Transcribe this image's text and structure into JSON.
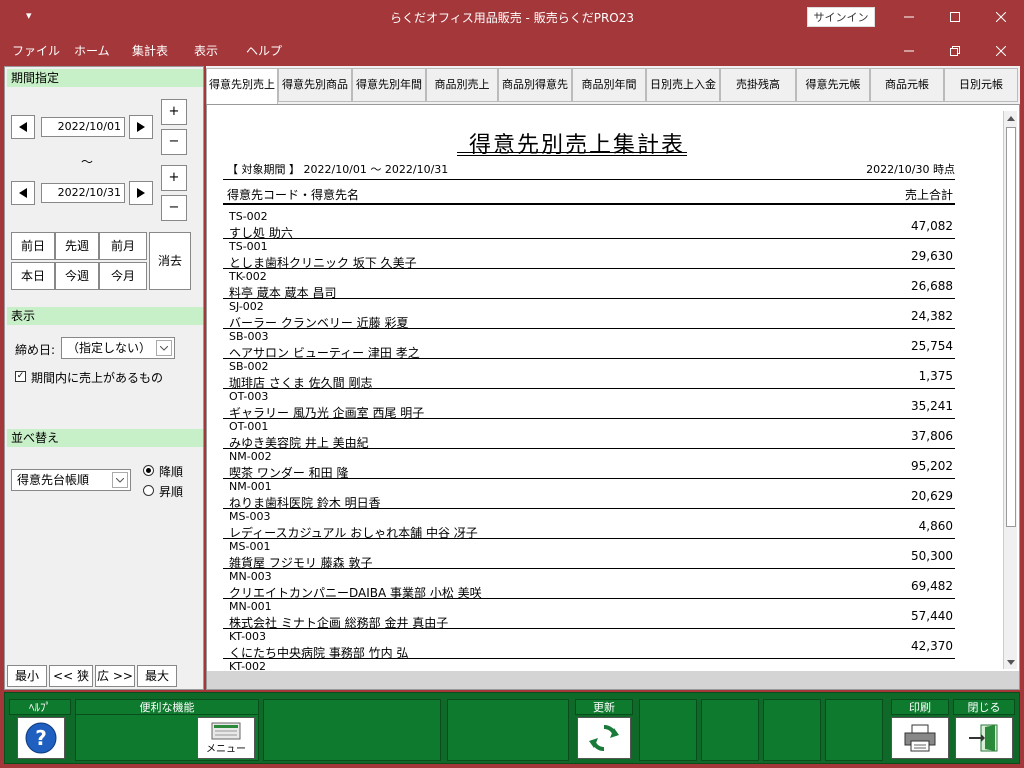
{
  "window": {
    "quick_access": "▾",
    "title": "らくだオフィス用品販売  -  販売らくだPRO23",
    "signin": "サインイン"
  },
  "menu": [
    "ファイル",
    "ホーム",
    "集計表",
    "表示",
    "ヘルプ"
  ],
  "left": {
    "period_header": "期間指定",
    "date_from": "2022/10/01",
    "date_to": "2022/10/31",
    "tilde": "～",
    "plus": "+",
    "minus": "−",
    "quick": [
      "前日",
      "先週",
      "前月",
      "本日",
      "今週",
      "今月"
    ],
    "clear": "消去",
    "display_header": "表示",
    "cutoff_label": "締め日:",
    "cutoff_value": "（指定しない）",
    "sales_check_label": "期間内に売上があるもの",
    "sort_header": "並べ替え",
    "sort_value": "得意先台帳順",
    "desc_label": "降順",
    "asc_label": "昇順",
    "zoom": [
      "最小",
      "<< 狭",
      "広 >>",
      "最大"
    ]
  },
  "tabs": [
    "得意先別売上",
    "得意先別商品",
    "得意先別年間",
    "商品別売上",
    "商品別得意先",
    "商品別年間",
    "日別売上入金",
    "売掛残高",
    "得意先元帳",
    "商品元帳",
    "日別元帳"
  ],
  "report": {
    "title": "得意先別売上集計表",
    "period": "【 対象期間 】 2022/10/01 ～ 2022/10/31",
    "asof": "2022/10/30 時点",
    "col_customer": "得意先コード・得意先名",
    "col_total": "売上合計",
    "rows": [
      {
        "code": "TS-002",
        "name": "すし処 助六",
        "amount": "47,082"
      },
      {
        "code": "TS-001",
        "name": "としま歯科クリニック 坂下 久美子",
        "amount": "29,630"
      },
      {
        "code": "TK-002",
        "name": "料亭 蔵本 蔵本 昌司",
        "amount": "26,688"
      },
      {
        "code": "SJ-002",
        "name": "バーラー クランベリー 近藤 彩夏",
        "amount": "24,382"
      },
      {
        "code": "SB-003",
        "name": "ヘアサロン ビューティー 津田 孝之",
        "amount": "25,754"
      },
      {
        "code": "SB-002",
        "name": "珈琲店 さくま 佐久間 剛志",
        "amount": "1,375"
      },
      {
        "code": "OT-003",
        "name": "ギャラリー 風乃光 企画室 西尾 明子",
        "amount": "35,241"
      },
      {
        "code": "OT-001",
        "name": "みゆき美容院 井上 美由紀",
        "amount": "37,806"
      },
      {
        "code": "NM-002",
        "name": "喫茶 ワンダー 和田 隆",
        "amount": "95,202"
      },
      {
        "code": "NM-001",
        "name": "ねりま歯科医院 鈴木 明日香",
        "amount": "20,629"
      },
      {
        "code": "MS-003",
        "name": "レディースカジュアル おしゃれ本舗 中谷 冴子",
        "amount": "4,860"
      },
      {
        "code": "MS-001",
        "name": "雑貨屋 フジモリ 藤森 敦子",
        "amount": "50,300"
      },
      {
        "code": "MN-003",
        "name": "クリエイトカンパニーDAIBA 事業部 小松 美咲",
        "amount": "69,482"
      },
      {
        "code": "MN-001",
        "name": "株式会社 ミナト企画 総務部 金井 真由子",
        "amount": "57,440"
      },
      {
        "code": "KT-003",
        "name": "くにたち中央病院 事務部 竹内 弘",
        "amount": "42,370"
      },
      {
        "code": "KT-002",
        "name": "",
        "amount": ""
      }
    ]
  },
  "bottom": {
    "help": "ﾍﾙﾌﾟ",
    "features": "便利な機能",
    "menu": "メニュー",
    "refresh": "更新",
    "print": "印刷",
    "close": "閉じる"
  }
}
